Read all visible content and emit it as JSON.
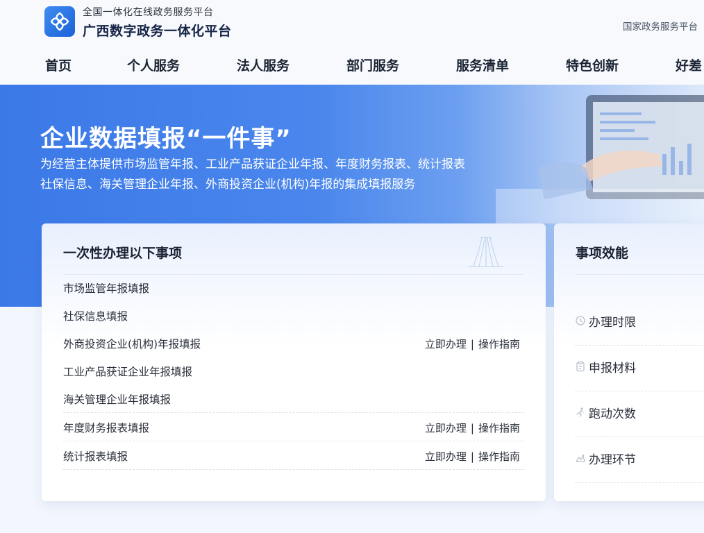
{
  "header": {
    "subtitle": "全国一体化在线政务服务平台",
    "title": "广西数字政务一体化平台",
    "national_link": "国家政务服务平台"
  },
  "nav": {
    "items": [
      {
        "label": "首页"
      },
      {
        "label": "个人服务"
      },
      {
        "label": "法人服务"
      },
      {
        "label": "部门服务"
      },
      {
        "label": "服务清单"
      },
      {
        "label": "特色创新"
      },
      {
        "label": "好差"
      }
    ]
  },
  "banner": {
    "title": "企业数据填报“一件事”",
    "desc_line1": "为经营主体提供市场监管年报、工业产品获证企业年报、年度财务报表、统计报表",
    "desc_line2": "社保信息、海关管理企业年报、外商投资企业(机构)年报的集成填报服务"
  },
  "items_card": {
    "title": "一次性办理以下事项",
    "items": [
      {
        "name": "市场监管年报填报",
        "apply": "",
        "guide": "",
        "sep": ""
      },
      {
        "name": "社保信息填报",
        "apply": "",
        "guide": "",
        "sep": ""
      },
      {
        "name": "外商投资企业(机构)年报填报",
        "apply": "立即办理",
        "guide": "操作指南",
        "sep": "|"
      },
      {
        "name": "工业产品获证企业年报填报",
        "apply": "",
        "guide": "",
        "sep": ""
      },
      {
        "name": "海关管理企业年报填报",
        "apply": "",
        "guide": "",
        "sep": ""
      },
      {
        "name": "年度财务报表填报",
        "apply": "立即办理",
        "guide": "操作指南",
        "sep": "|"
      },
      {
        "name": "统计报表填报",
        "apply": "立即办理",
        "guide": "操作指南",
        "sep": "|"
      }
    ]
  },
  "effect_card": {
    "title": "事项效能",
    "items": [
      {
        "label": "办理时限",
        "icon": "clock-icon"
      },
      {
        "label": "申报材料",
        "icon": "clipboard-icon"
      },
      {
        "label": "跑动次数",
        "icon": "running-person-icon"
      },
      {
        "label": "办理环节",
        "icon": "steps-icon"
      }
    ]
  },
  "colors": {
    "brand_blue": "#3b79e8",
    "text_dark": "#1f2733"
  }
}
